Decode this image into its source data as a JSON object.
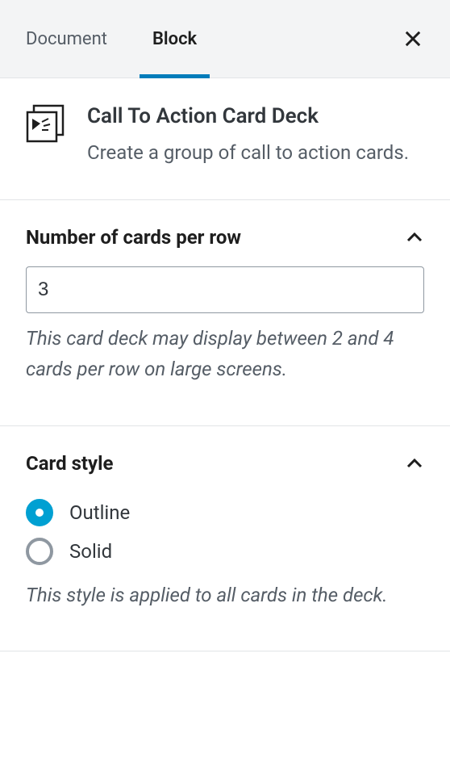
{
  "tabs": {
    "document": "Document",
    "block": "Block"
  },
  "block": {
    "title": "Call To Action Card Deck",
    "description": "Create a group of call to action cards."
  },
  "panels": {
    "cardsPerRow": {
      "title": "Number of cards per row",
      "value": "3",
      "help": "This card deck may display between 2 and 4 cards per row on large screens."
    },
    "cardStyle": {
      "title": "Card style",
      "options": {
        "outline": "Outline",
        "solid": "Solid"
      },
      "help": "This style is applied to all cards in the deck."
    }
  }
}
